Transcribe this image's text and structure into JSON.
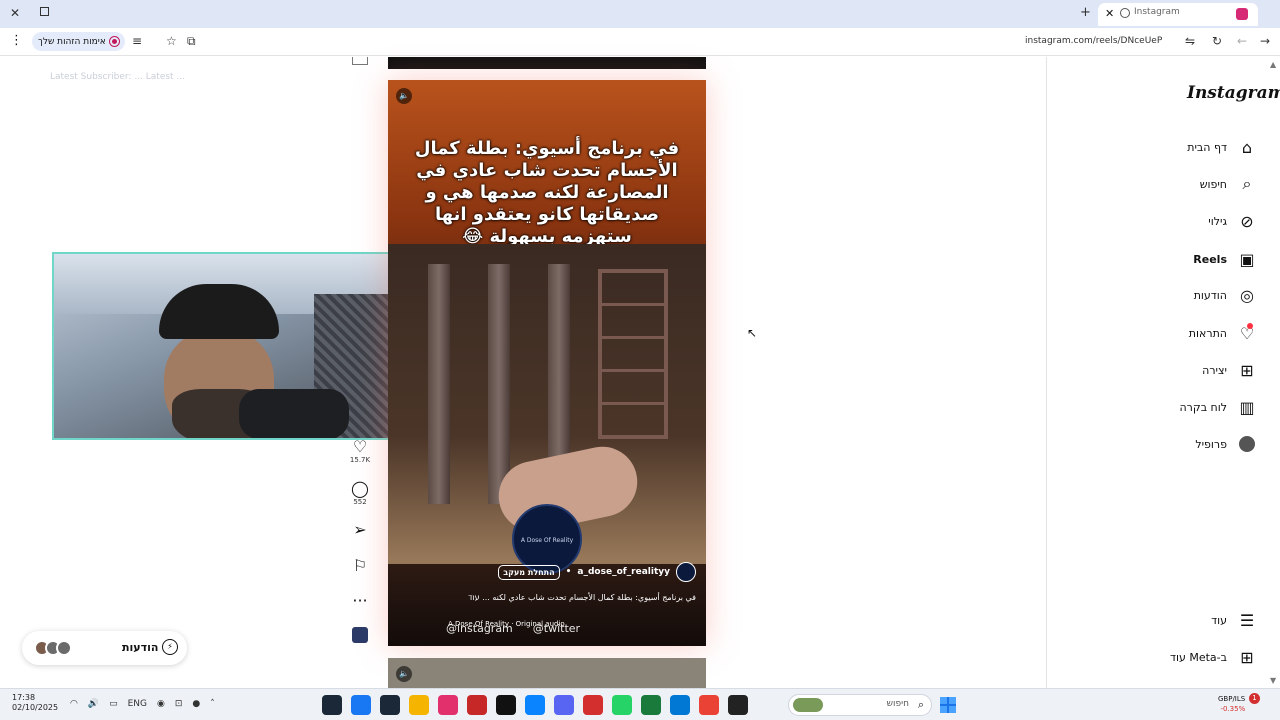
{
  "browser": {
    "tab": {
      "title": "Instagram",
      "close": "✕"
    },
    "new_tab": "+",
    "window_close": "✕",
    "ghost_title": "",
    "toolbar": {
      "menu": "⋮",
      "identity_label": "אימות הזהות שלך",
      "address": "instagram.com/reels/DNceUeP"
    }
  },
  "overlay": {
    "label": "Latest Subscriber: ... Latest ..."
  },
  "reel": {
    "caption": "في برنامج أسيوي: بطلة كمال الأجسام تحدت شاب عادي في المصارعة لكنه صدمها هي و صديقاتها كانو يعتقدو انها ستهزمه بسهولة 😂",
    "username": "a_dose_of_realityy",
    "follow": "התחלת מעקב",
    "description": "في برنامج أسيوي: بطلة كمال الأجسام تحدت شاب عادي لكنه ... עוד",
    "music": "A Dose Of Reality · Original audio",
    "logo_text": "A Dose Of Reality",
    "mute_icon": "🔈"
  },
  "watermark": {
    "instagram": "@instagram",
    "twitter": "@twitter",
    "pill": ""
  },
  "actions": {
    "likes": "15.7K",
    "comments": "552"
  },
  "messages_pill": {
    "label": "הודעות"
  },
  "sidebar": {
    "logo": "Instagram",
    "items": [
      {
        "label": "דף הבית",
        "icon": "⌂"
      },
      {
        "label": "חיפוש",
        "icon": "⌕"
      },
      {
        "label": "גילוי",
        "icon": "⊘"
      },
      {
        "label": "Reels",
        "icon": "▣"
      },
      {
        "label": "הודעות",
        "icon": "◎"
      },
      {
        "label": "התראות",
        "icon": "♡"
      },
      {
        "label": "יצירה",
        "icon": "⊞"
      },
      {
        "label": "לוח בקרה",
        "icon": "▥"
      },
      {
        "label": "פרופיל",
        "icon": "●"
      }
    ],
    "more": {
      "label": "עוד",
      "icon": "☰"
    },
    "meta": {
      "label": "עוד Meta-ב",
      "icon": "⊞"
    }
  },
  "taskbar": {
    "time": "17:38",
    "date": "02/10/2025",
    "lang": "ENG",
    "search_placeholder": "חיפוש",
    "ticker_pair": "GBP/ILS",
    "ticker_change": "-0.35%",
    "badge": "1",
    "app_colors": [
      "#1b2838",
      "#1877f2",
      "#1b2838",
      "#f4b400",
      "#e1306c",
      "#c62828",
      "#111111",
      "#0a84ff",
      "#5865f2",
      "#d32f2f",
      "#25d366",
      "#1a7a3c",
      "#0078d4",
      "#ea4335",
      "#222222"
    ]
  }
}
